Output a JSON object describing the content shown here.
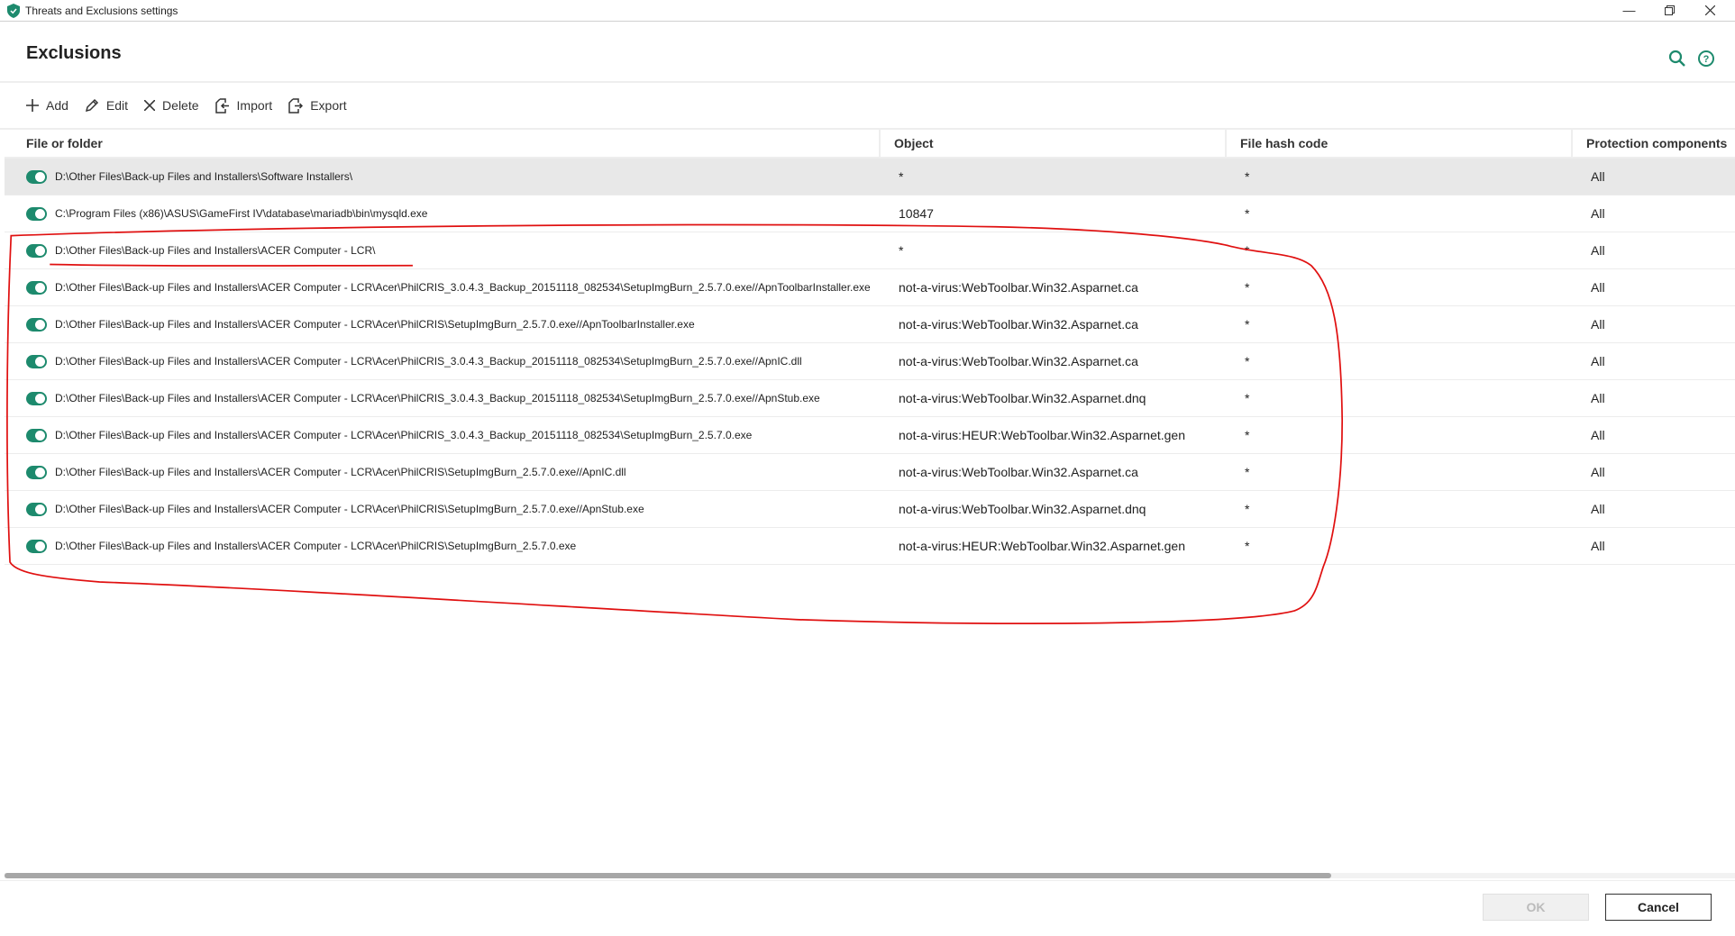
{
  "window": {
    "title": "Threats and Exclusions settings"
  },
  "header": {
    "title": "Exclusions"
  },
  "toolbar": {
    "add": "Add",
    "edit": "Edit",
    "delete": "Delete",
    "import": "Import",
    "export": "Export"
  },
  "table": {
    "columns": [
      "File or folder",
      "Object",
      "File hash code",
      "Protection components"
    ],
    "rows": [
      {
        "path": "D:\\Other Files\\Back-up Files and Installers\\Software Installers\\",
        "object": "*",
        "hash": "*",
        "components": "All"
      },
      {
        "path": "C:\\Program Files (x86)\\ASUS\\GameFirst IV\\database\\mariadb\\bin\\mysqld.exe",
        "object": "10847",
        "hash": "*",
        "components": "All"
      },
      {
        "path": "D:\\Other Files\\Back-up Files and Installers\\ACER Computer - LCR\\",
        "object": "*",
        "hash": "*",
        "components": "All"
      },
      {
        "path": "D:\\Other Files\\Back-up Files and Installers\\ACER Computer - LCR\\Acer\\PhilCRIS_3.0.4.3_Backup_20151118_082534\\SetupImgBurn_2.5.7.0.exe//ApnToolbarInstaller.exe",
        "object": "not-a-virus:WebToolbar.Win32.Asparnet.ca",
        "hash": "*",
        "components": "All"
      },
      {
        "path": "D:\\Other Files\\Back-up Files and Installers\\ACER Computer - LCR\\Acer\\PhilCRIS\\SetupImgBurn_2.5.7.0.exe//ApnToolbarInstaller.exe",
        "object": "not-a-virus:WebToolbar.Win32.Asparnet.ca",
        "hash": "*",
        "components": "All"
      },
      {
        "path": "D:\\Other Files\\Back-up Files and Installers\\ACER Computer - LCR\\Acer\\PhilCRIS_3.0.4.3_Backup_20151118_082534\\SetupImgBurn_2.5.7.0.exe//ApnIC.dll",
        "object": "not-a-virus:WebToolbar.Win32.Asparnet.ca",
        "hash": "*",
        "components": "All"
      },
      {
        "path": "D:\\Other Files\\Back-up Files and Installers\\ACER Computer - LCR\\Acer\\PhilCRIS_3.0.4.3_Backup_20151118_082534\\SetupImgBurn_2.5.7.0.exe//ApnStub.exe",
        "object": "not-a-virus:WebToolbar.Win32.Asparnet.dnq",
        "hash": "*",
        "components": "All"
      },
      {
        "path": "D:\\Other Files\\Back-up Files and Installers\\ACER Computer - LCR\\Acer\\PhilCRIS_3.0.4.3_Backup_20151118_082534\\SetupImgBurn_2.5.7.0.exe",
        "object": "not-a-virus:HEUR:WebToolbar.Win32.Asparnet.gen",
        "hash": "*",
        "components": "All"
      },
      {
        "path": "D:\\Other Files\\Back-up Files and Installers\\ACER Computer - LCR\\Acer\\PhilCRIS\\SetupImgBurn_2.5.7.0.exe//ApnIC.dll",
        "object": "not-a-virus:WebToolbar.Win32.Asparnet.ca",
        "hash": "*",
        "components": "All"
      },
      {
        "path": "D:\\Other Files\\Back-up Files and Installers\\ACER Computer - LCR\\Acer\\PhilCRIS\\SetupImgBurn_2.5.7.0.exe//ApnStub.exe",
        "object": "not-a-virus:WebToolbar.Win32.Asparnet.dnq",
        "hash": "*",
        "components": "All"
      },
      {
        "path": "D:\\Other Files\\Back-up Files and Installers\\ACER Computer - LCR\\Acer\\PhilCRIS\\SetupImgBurn_2.5.7.0.exe",
        "object": "not-a-virus:HEUR:WebToolbar.Win32.Asparnet.gen",
        "hash": "*",
        "components": "All"
      }
    ]
  },
  "footer": {
    "ok": "OK",
    "cancel": "Cancel"
  },
  "colors": {
    "accent": "#1d8a6d",
    "annotation": "#e01010"
  }
}
